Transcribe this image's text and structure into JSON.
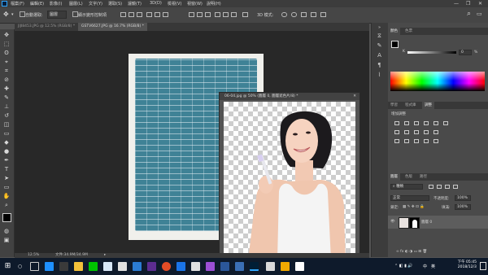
{
  "menubar": {
    "app_logo": "Ps",
    "items": [
      "檔案(F)",
      "編輯(E)",
      "影像(I)",
      "圖層(L)",
      "文字(Y)",
      "選取(S)",
      "濾鏡(T)",
      "3D(D)",
      "檢視(V)",
      "視窗(W)",
      "說明(H)"
    ],
    "window_buttons": [
      "—",
      "❐",
      "✕"
    ]
  },
  "options": {
    "auto_select_label": "自動選取:",
    "auto_select_value": "圖層",
    "transform_label": "顯示變形控制項",
    "mode_label": "3D 模式:"
  },
  "tabs": [
    {
      "label": "JIJI8453.JPG @ 12.5% (RGB/8) *",
      "active": false
    },
    {
      "label": "GSTV6627.JPG @ 16.7% (RGB/8) *",
      "active": true
    }
  ],
  "floating_window": {
    "title": "06-04.jpg @ 50% (圖層 0, 圖層遮色片/8) *",
    "close": "✕"
  },
  "statusbar": {
    "zoom": "12.5%",
    "doc": "文件:34.9M/34.9M",
    "arrow": "▸"
  },
  "panels": {
    "color_tabs": [
      "顏色",
      "色票"
    ],
    "color_value": "0",
    "color_unit": "%",
    "adjust_tabs": [
      "學習",
      "程式庫",
      "調整"
    ],
    "adjust_heading": "增加調整",
    "layers_tabs": [
      "圖層",
      "色版",
      "路徑"
    ],
    "kind_label": "種類",
    "blend_mode": "正常",
    "opacity_label": "不透明度:",
    "opacity_value": "100%",
    "lock_label": "鎖定:",
    "fill_label": "填滿:",
    "fill_value": "100%",
    "layer_name": "圖層 0",
    "eye": "👁"
  },
  "tools": [
    {
      "name": "move-tool",
      "glyph": "✥"
    },
    {
      "name": "marquee-tool",
      "glyph": "⬚"
    },
    {
      "name": "lasso-tool",
      "glyph": "ʘ"
    },
    {
      "name": "quick-select-tool",
      "glyph": "⌖"
    },
    {
      "name": "crop-tool",
      "glyph": "⌗"
    },
    {
      "name": "eyedropper-tool",
      "glyph": "⊘"
    },
    {
      "name": "healing-tool",
      "glyph": "✚"
    },
    {
      "name": "brush-tool",
      "glyph": "✎"
    },
    {
      "name": "stamp-tool",
      "glyph": "⊥"
    },
    {
      "name": "history-brush-tool",
      "glyph": "↺"
    },
    {
      "name": "eraser-tool",
      "glyph": "◫"
    },
    {
      "name": "gradient-tool",
      "glyph": "▭"
    },
    {
      "name": "blur-tool",
      "glyph": "◆"
    },
    {
      "name": "dodge-tool",
      "glyph": "●"
    },
    {
      "name": "pen-tool",
      "glyph": "✒"
    },
    {
      "name": "type-tool",
      "glyph": "T"
    },
    {
      "name": "path-select-tool",
      "glyph": "➤"
    },
    {
      "name": "shape-tool",
      "glyph": "▭"
    },
    {
      "name": "hand-tool",
      "glyph": "✋"
    },
    {
      "name": "zoom-tool",
      "glyph": "⌕"
    }
  ],
  "taskbar": {
    "start": "⊞",
    "search": "○",
    "time": "下午 05:45",
    "date": "2018/12/3",
    "ime": "中",
    "lang": "英"
  },
  "colors": {
    "accent": "#31a8ff",
    "brick": "#3f8296",
    "canvas_bg": "#282828"
  }
}
